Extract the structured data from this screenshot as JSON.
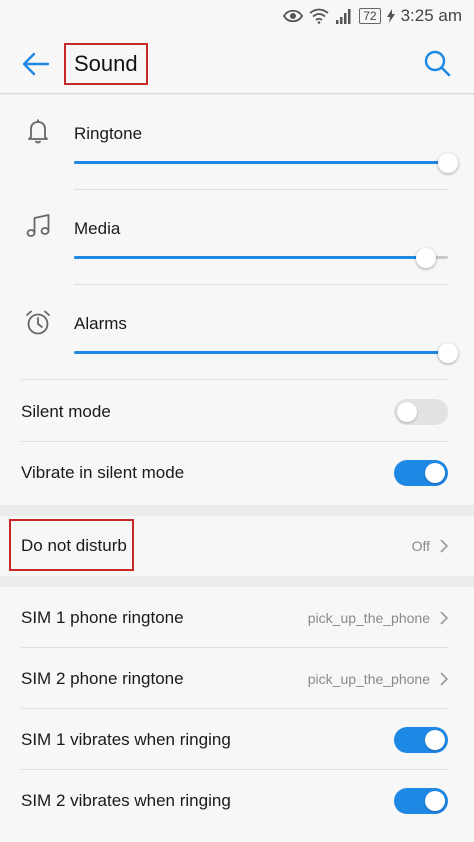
{
  "status_bar": {
    "battery": "72",
    "time": "3:25 am",
    "icons": [
      "eye-icon",
      "wifi-icon",
      "signal-icon",
      "battery-icon",
      "charging-icon"
    ]
  },
  "header": {
    "title": "Sound",
    "back_icon": "back-arrow-icon",
    "search_icon": "search-icon"
  },
  "volumes": [
    {
      "label": "Ringtone",
      "icon": "bell-icon",
      "level": 1.0
    },
    {
      "label": "Media",
      "icon": "music-note-icon",
      "level": 0.94
    },
    {
      "label": "Alarms",
      "icon": "alarm-clock-icon",
      "level": 1.0
    }
  ],
  "toggles": [
    {
      "label": "Silent mode",
      "on": false
    },
    {
      "label": "Vibrate in silent mode",
      "on": true
    }
  ],
  "do_not_disturb": {
    "label": "Do not disturb",
    "value": "Off"
  },
  "sim_settings": [
    {
      "label": "SIM 1 phone ringtone",
      "type": "value",
      "value": "pick_up_the_phone"
    },
    {
      "label": "SIM 2 phone ringtone",
      "type": "value",
      "value": "pick_up_the_phone"
    },
    {
      "label": "SIM 1 vibrates when ringing",
      "type": "toggle",
      "on": true
    },
    {
      "label": "SIM 2 vibrates when ringing",
      "type": "toggle",
      "on": true
    }
  ],
  "colors": {
    "accent": "#1e88e5",
    "highlight_box": "#c62828",
    "secondary_text": "#8a8a8a"
  }
}
